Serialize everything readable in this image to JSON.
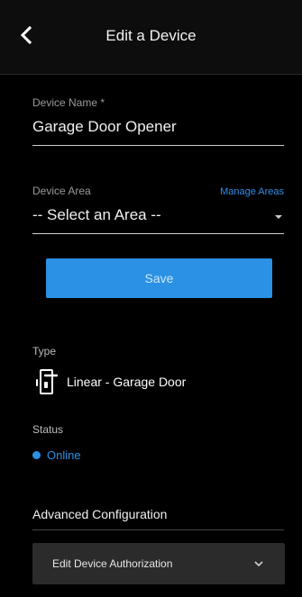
{
  "header": {
    "title": "Edit a Device"
  },
  "device_name": {
    "label": "Device Name *",
    "value": "Garage Door Opener"
  },
  "device_area": {
    "label": "Device Area",
    "value": "-- Select an Area --",
    "manage_link": "Manage Areas"
  },
  "save_label": "Save",
  "type": {
    "label": "Type",
    "value": "Linear - Garage Door",
    "icon": "garage-door-handle-icon"
  },
  "status": {
    "label": "Status",
    "value": "Online",
    "color": "#2a91e4"
  },
  "advanced": {
    "title": "Advanced Configuration",
    "auth_label": "Edit Device Authorization"
  },
  "colors": {
    "accent": "#2a91e4",
    "background": "#000000"
  }
}
